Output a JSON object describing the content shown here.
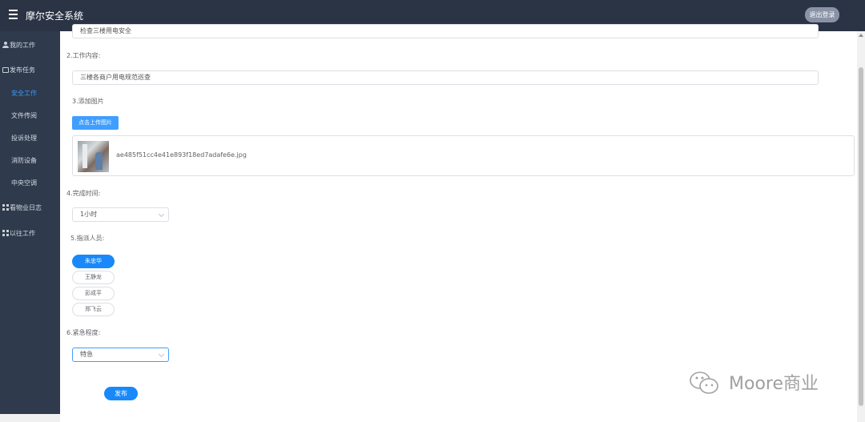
{
  "header": {
    "app_title": "摩尔安全系统",
    "logout_label": "退出登录"
  },
  "sidebar": {
    "items": [
      {
        "label": "我的工作",
        "icon": "person-icon"
      },
      {
        "label": "发布任务",
        "icon": "folder-icon"
      },
      {
        "label": "安全工作",
        "active": true
      },
      {
        "label": "文件传阅"
      },
      {
        "label": "投诉处理"
      },
      {
        "label": "消防设备"
      },
      {
        "label": "中央空调"
      },
      {
        "label": "看物业日志",
        "icon": "grid-icon"
      },
      {
        "label": "以往工作",
        "icon": "grid-icon"
      }
    ]
  },
  "form": {
    "title_value_partial": "检查三楼用电安全",
    "content_label": "2.工作内容:",
    "content_value": "三楼各商户用电规范巡查",
    "images_label": "3.添加图片",
    "upload_label": "点击上传图片",
    "file_name": "ae485f51cc4e41e893f18ed7adafe6e.jpg",
    "time_label": "4.完成时间:",
    "time_value": "1小时",
    "assign_label": "5.指派人员:",
    "people": [
      {
        "name": "朱忠华",
        "selected": true
      },
      {
        "name": "王静龙",
        "selected": false
      },
      {
        "name": "彭成平",
        "selected": false
      },
      {
        "name": "郑飞云",
        "selected": false
      }
    ],
    "urgency_label": "6.紧急程度:",
    "urgency_value": "特急",
    "publish_label": "发布"
  },
  "watermark": {
    "text": "Moore商业"
  },
  "colors": {
    "topbar": "#2b3445",
    "sidebar": "#2f3a4c",
    "accent": "#1989fa",
    "active_nav": "#3a9bff"
  }
}
